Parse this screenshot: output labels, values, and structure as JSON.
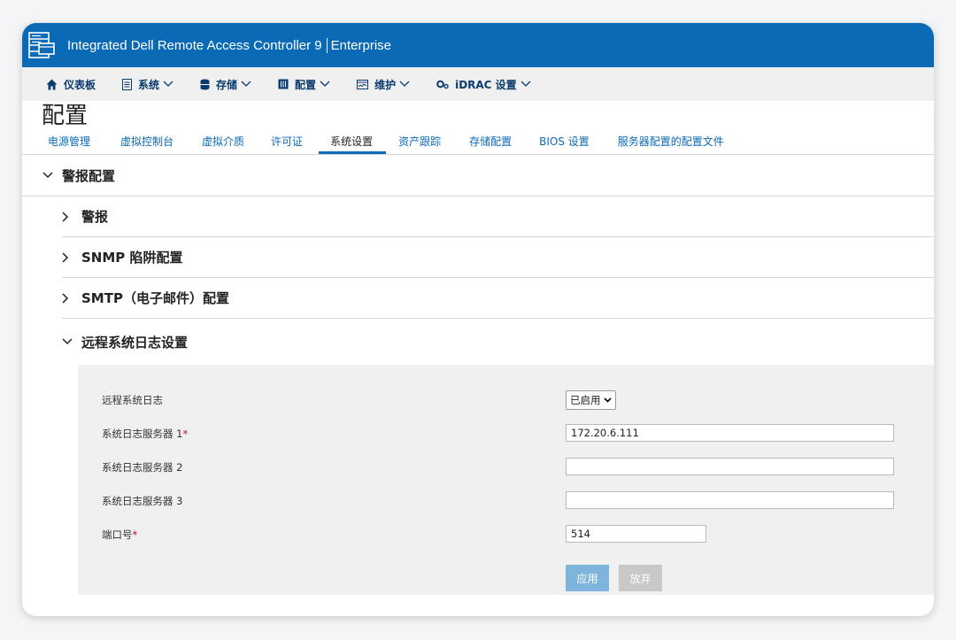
{
  "app": {
    "title": "Integrated Dell Remote Access Controller 9",
    "edition": "Enterprise"
  },
  "nav": [
    {
      "label": "仪表板",
      "icon": "home-icon",
      "dropdown": false
    },
    {
      "label": "系统",
      "icon": "system-icon",
      "dropdown": true
    },
    {
      "label": "存储",
      "icon": "storage-icon",
      "dropdown": true
    },
    {
      "label": "配置",
      "icon": "config-icon",
      "dropdown": true
    },
    {
      "label": "维护",
      "icon": "maintenance-icon",
      "dropdown": true
    },
    {
      "label": "iDRAC 设置",
      "icon": "idrac-settings-icon",
      "dropdown": true
    }
  ],
  "page_title": "配置",
  "tabs": [
    {
      "label": "电源管理",
      "active": false
    },
    {
      "label": "虚拟控制台",
      "active": false
    },
    {
      "label": "虚拟介质",
      "active": false
    },
    {
      "label": "许可证",
      "active": false
    },
    {
      "label": "系统设置",
      "active": true
    },
    {
      "label": "资产跟踪",
      "active": false
    },
    {
      "label": "存储配置",
      "active": false
    },
    {
      "label": "BIOS 设置",
      "active": false
    },
    {
      "label": "服务器配置的配置文件",
      "active": false
    }
  ],
  "alert_config": {
    "label": "警报配置",
    "expanded": true,
    "subsections": [
      {
        "label": "警报",
        "expanded": false
      },
      {
        "label": "SNMP 陷阱配置",
        "expanded": false
      },
      {
        "label": "SMTP（电子邮件）配置",
        "expanded": false
      },
      {
        "label": "远程系统日志设置",
        "expanded": true
      }
    ]
  },
  "remote_syslog": {
    "enable": {
      "label": "远程系统日志",
      "value": "已启用"
    },
    "server1": {
      "label": "系统日志服务器 1",
      "required": "*",
      "value": "172.20.6.111"
    },
    "server2": {
      "label": "系统日志服务器 2",
      "value": ""
    },
    "server3": {
      "label": "系统日志服务器 3",
      "value": ""
    },
    "port": {
      "label": "端口号",
      "required": "*",
      "value": "514"
    },
    "apply_label": "应用",
    "discard_label": "放弃"
  },
  "colors": {
    "brand_blue": "#0b6ab6",
    "nav_text": "#0a3a6e",
    "required": "#d0021b",
    "apply_button": "#7fb5dd",
    "discard_button": "#c8c8c8"
  }
}
